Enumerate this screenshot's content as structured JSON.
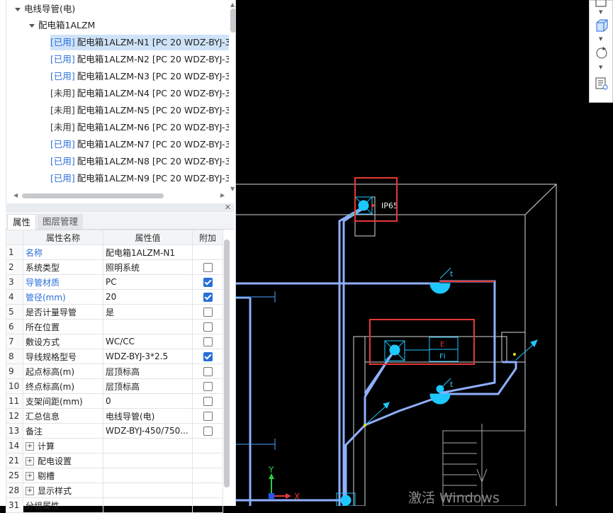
{
  "tree": {
    "root_label": "电线导管(电)",
    "child_label": "配电箱1ALZM",
    "items": [
      {
        "status": "[已用]",
        "label": "配电箱1ALZM-N1 [PC 20 WDZ-BYJ-3",
        "used": true,
        "selected": true
      },
      {
        "status": "[已用]",
        "label": "配电箱1ALZM-N2 [PC 20 WDZ-BYJ-3",
        "used": true
      },
      {
        "status": "[已用]",
        "label": "配电箱1ALZM-N3 [PC 20 WDZ-BYJ-3",
        "used": true
      },
      {
        "status": "[未用]",
        "label": "配电箱1ALZM-N4 [PC 20 WDZ-BYJ-3",
        "used": false
      },
      {
        "status": "[未用]",
        "label": "配电箱1ALZM-N5 [PC 20 WDZ-BYJ-3",
        "used": false
      },
      {
        "status": "[未用]",
        "label": "配电箱1ALZM-N6 [PC 20 WDZ-BYJ-3",
        "used": false
      },
      {
        "status": "[已用]",
        "label": "配电箱1ALZM-N7 [PC 20 WDZ-BYJ-3",
        "used": true
      },
      {
        "status": "[已用]",
        "label": "配电箱1ALZM-N8 [PC 20 WDZ-BYJ-3",
        "used": true
      },
      {
        "status": "[已用]",
        "label": "配电箱1ALZM-N9 [PC 20 WDZ-BYJ-3",
        "used": true
      }
    ]
  },
  "tabs": [
    "属性",
    "图层管理"
  ],
  "table": {
    "headers": [
      "",
      "属性名称",
      "属性值",
      "附加"
    ],
    "rows": [
      {
        "num": "1",
        "name": "名称",
        "value": "配电箱1ALZM-N1",
        "blue": true,
        "check": null
      },
      {
        "num": "2",
        "name": "系统类型",
        "value": "照明系统",
        "blue": false,
        "check": false
      },
      {
        "num": "3",
        "name": "导管材质",
        "value": "PC",
        "blue": true,
        "check": true
      },
      {
        "num": "4",
        "name": "管径(mm)",
        "value": "20",
        "blue": true,
        "check": true
      },
      {
        "num": "5",
        "name": "是否计量导管",
        "value": "是",
        "blue": false,
        "check": false
      },
      {
        "num": "6",
        "name": "所在位置",
        "value": "",
        "blue": false,
        "check": false
      },
      {
        "num": "7",
        "name": "敷设方式",
        "value": "WC/CC",
        "blue": false,
        "check": false
      },
      {
        "num": "8",
        "name": "导线规格型号",
        "value": "WDZ-BYJ-3*2.5",
        "blue": false,
        "check": true
      },
      {
        "num": "9",
        "name": "起点标高(m)",
        "value": "层顶标高",
        "blue": false,
        "check": false
      },
      {
        "num": "10",
        "name": "终点标高(m)",
        "value": "层顶标高",
        "blue": false,
        "check": false
      },
      {
        "num": "11",
        "name": "支架间距(mm)",
        "value": "0",
        "blue": false,
        "check": false
      },
      {
        "num": "12",
        "name": "汇总信息",
        "value": "电线导管(电)",
        "blue": false,
        "check": false
      },
      {
        "num": "13",
        "name": "备注",
        "value": "WDZ-BYJ-450/750...",
        "blue": false,
        "check": false
      },
      {
        "num": "14",
        "name": "计算",
        "value": "",
        "group": true
      },
      {
        "num": "21",
        "name": "配电设置",
        "value": "",
        "group": true
      },
      {
        "num": "25",
        "name": "剔槽",
        "value": "",
        "group": true
      },
      {
        "num": "28",
        "name": "显示样式",
        "value": "",
        "group": true
      },
      {
        "num": "31",
        "name": "分组属性",
        "value": "",
        "group": false
      }
    ]
  },
  "cad": {
    "label_ip65": "IP65",
    "label_t1": "t",
    "label_t2": "t",
    "box_top": "E",
    "box_bottom": "Fl",
    "axis_y": "Y",
    "axis_x": "X"
  },
  "toolbar": {
    "icons": [
      "view-icon",
      "cube-icon",
      "rotate-icon",
      "layer-list-icon"
    ]
  },
  "watermark": "激活 Windows",
  "colors": {
    "accent": "#2a6ed8",
    "pipe": "#8fb0ff",
    "device": "#1ec8ff",
    "highlight": "#e53935"
  }
}
